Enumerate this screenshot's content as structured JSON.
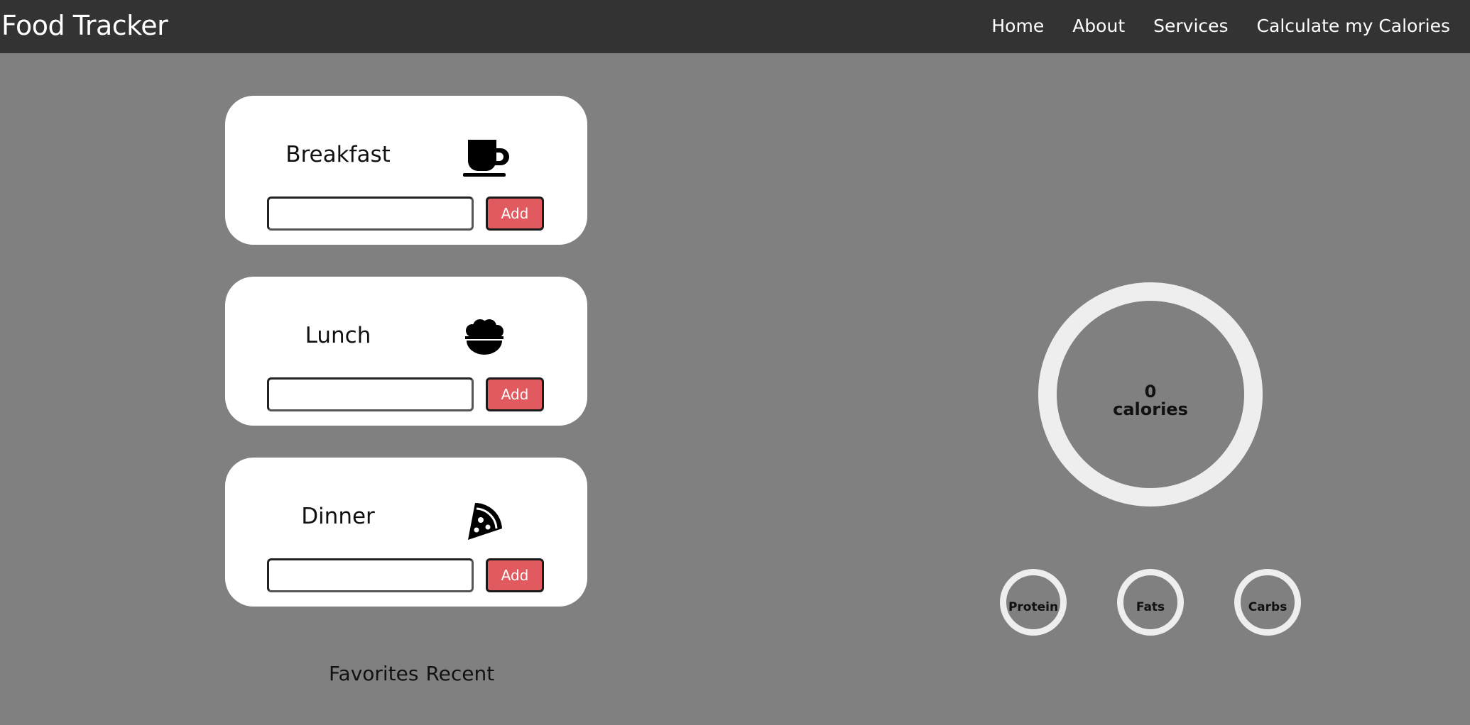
{
  "header": {
    "brand": "Food Tracker",
    "nav": [
      "Home",
      "About",
      "Services",
      "Calculate my Calories"
    ]
  },
  "meals": [
    {
      "title": "Breakfast",
      "icon": "coffee-cup-icon",
      "input_value": "",
      "button_label": "Add"
    },
    {
      "title": "Lunch",
      "icon": "bowl-icon",
      "input_value": "",
      "button_label": "Add"
    },
    {
      "title": "Dinner",
      "icon": "pizza-slice-icon",
      "input_value": "",
      "button_label": "Add"
    }
  ],
  "tabs": [
    "Favorites",
    "Recent"
  ],
  "summary": {
    "calories_value": "0",
    "calories_label": "calories",
    "macros": [
      "Protein",
      "Fats",
      "Carbs"
    ]
  },
  "colors": {
    "background": "#808080",
    "navbar": "#333333",
    "card": "#ffffff",
    "add_button": "#e05a5f",
    "ring": "#eeeeee"
  }
}
